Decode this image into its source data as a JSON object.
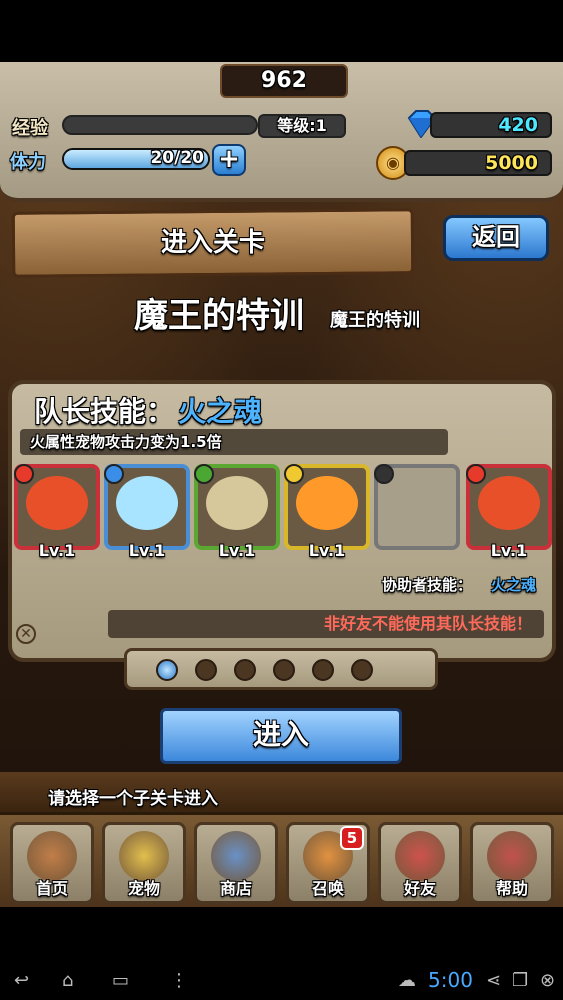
{
  "hud": {
    "score": "962",
    "exp_label": "经验",
    "level": "等级:1",
    "stamina_label": "体力",
    "stamina": "20/20",
    "stamina_fraction": 1.0,
    "plus_symbol": "+",
    "gems": "420",
    "coins": "5000",
    "gems_color": "#4de7ff",
    "coins_color": "#ffe55a"
  },
  "header": {
    "title": "进入关卡",
    "back_label": "返回"
  },
  "stage": {
    "title": "魔王的特训",
    "subtitle": "魔王的特训"
  },
  "team": {
    "leader_prefix": "队长技能：",
    "leader_skill": "火之魂",
    "leader_desc": "火属性宠物攻击力变为1.5倍",
    "slots": [
      {
        "level": "Lv.1",
        "element": "fire",
        "border": "#c9303a",
        "face": "#e8502a"
      },
      {
        "level": "Lv.1",
        "element": "water",
        "border": "#4a8fd6",
        "face": "#a8e4ff"
      },
      {
        "level": "Lv.1",
        "element": "wood",
        "border": "#5aa832",
        "face": "#d6c89a"
      },
      {
        "level": "Lv.1",
        "element": "light",
        "border": "#d8b82a",
        "face": "#ff9a2a"
      },
      {
        "level": "",
        "element": "empty",
        "border": "#777",
        "face": "transparent"
      }
    ],
    "helper": {
      "level": "Lv.1",
      "element": "fire",
      "border": "#c9303a",
      "face": "#e8502a"
    },
    "helper_label": "协助者技能：",
    "helper_skill": "火之魂",
    "warning": "非好友不能使用其队长技能！",
    "close_symbol": "✕",
    "page_count": 6,
    "active_page": 1
  },
  "enter_label": "进入",
  "hint": "请选择一个子关卡进入",
  "nav": [
    {
      "label": "首页",
      "icon": "home-icon"
    },
    {
      "label": "宠物",
      "icon": "pet-icon"
    },
    {
      "label": "商店",
      "icon": "shop-icon"
    },
    {
      "label": "召唤",
      "icon": "summon-icon"
    },
    {
      "label": "好友",
      "icon": "friends-icon"
    },
    {
      "label": "帮助",
      "icon": "help-icon"
    }
  ],
  "summon_badge": "5",
  "system": {
    "time": "5:00"
  }
}
